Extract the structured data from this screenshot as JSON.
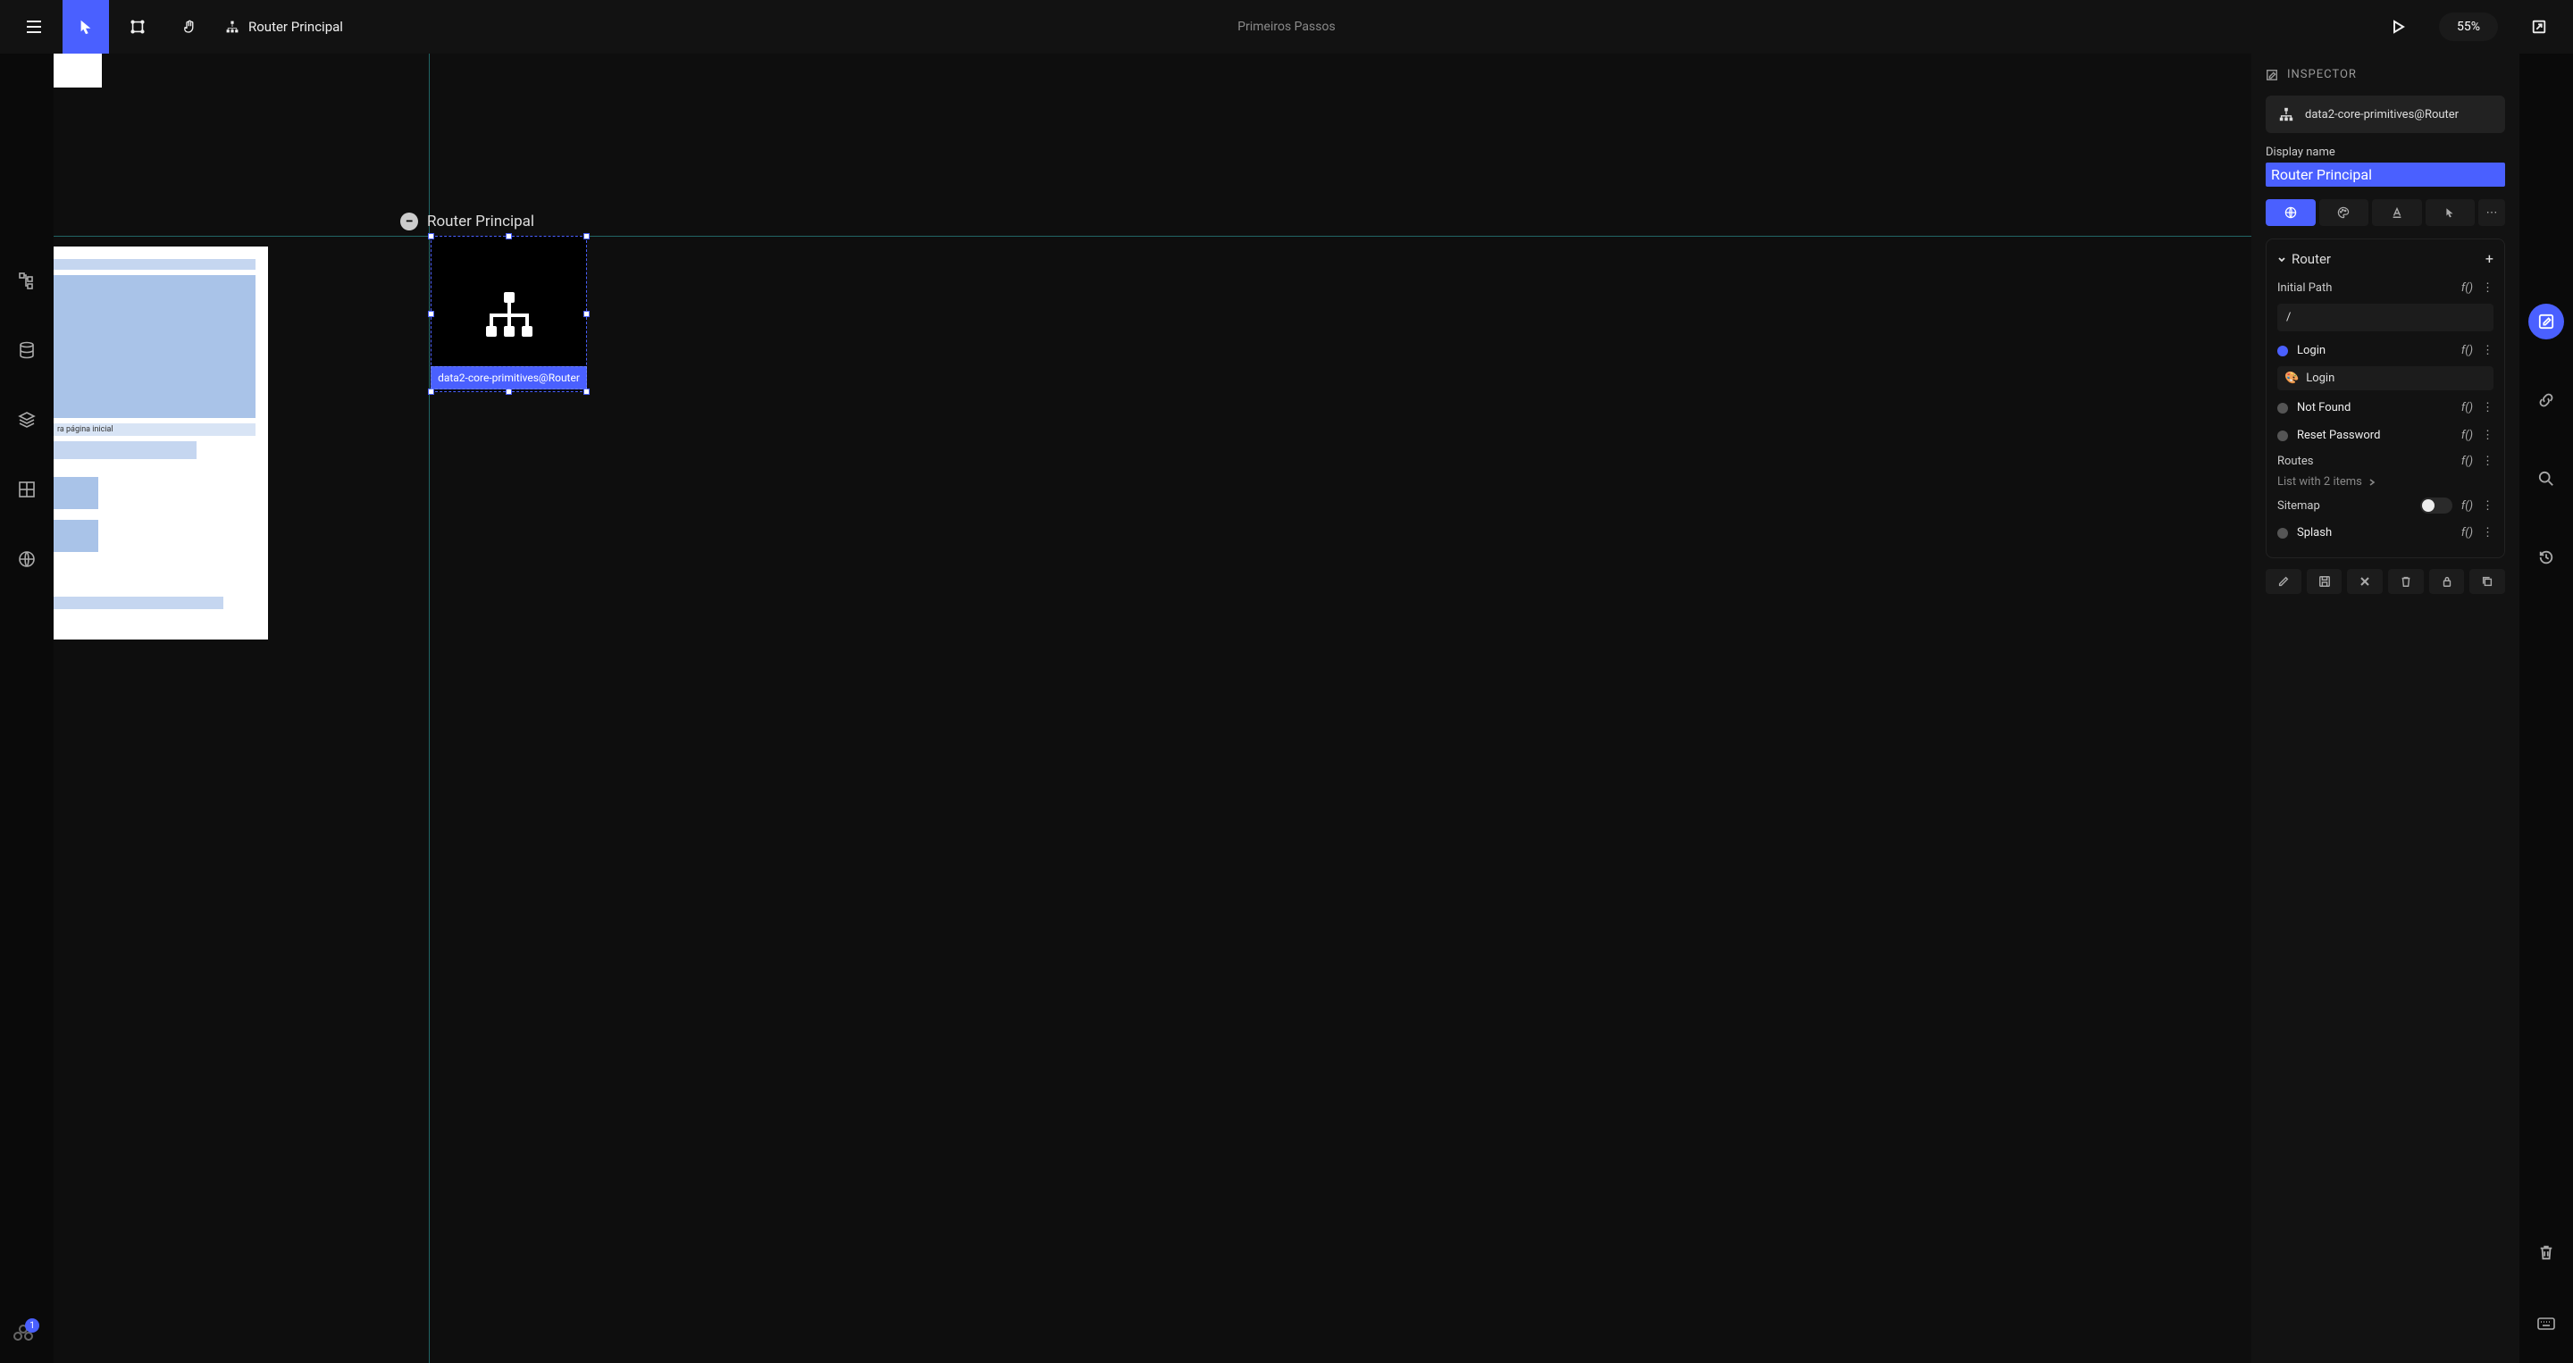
{
  "topbar": {
    "breadcrumb_text": "Router Principal",
    "center_title": "Primeiros Passos",
    "zoom": "55%"
  },
  "leftbar": {
    "avatar_count": "1"
  },
  "canvas": {
    "router_label": "Router Principal",
    "node_caption": "data2-core-primitives@Router",
    "preview_text": "ra página inicial"
  },
  "inspector": {
    "header": "INSPECTOR",
    "chip_label": "data2-core-primitives@Router",
    "display_name_label": "Display name",
    "display_name_value": "Router Principal",
    "section_title": "Router",
    "initial_path_label": "Initial Path",
    "initial_path_value": "/",
    "routes": [
      {
        "label": "Login",
        "active": true,
        "linked": "Login"
      },
      {
        "label": "Not Found",
        "active": false
      },
      {
        "label": "Reset Password",
        "active": false
      }
    ],
    "routes_label": "Routes",
    "routes_summary": "List with 2 items",
    "sitemap_label": "Sitemap",
    "splash_label": "Splash",
    "fx_label": "f()"
  }
}
